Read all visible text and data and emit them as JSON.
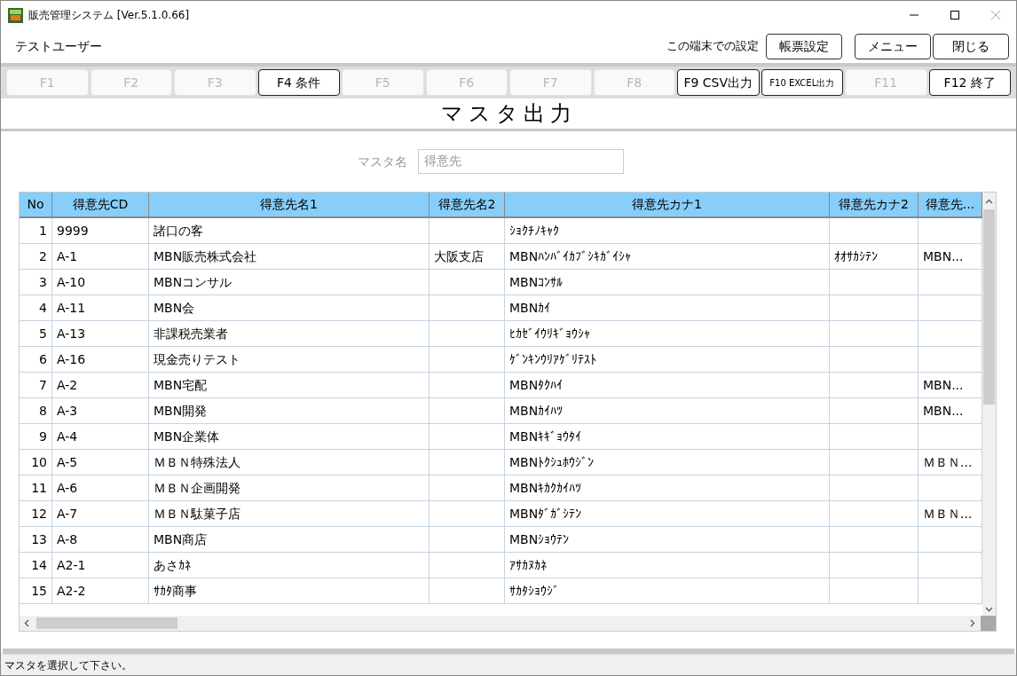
{
  "window": {
    "title": "販売管理システム [Ver.5.1.0.66]"
  },
  "header": {
    "user": "テストユーザー",
    "settings_label": "この端末での設定",
    "buttons": [
      "帳票設定",
      "メニュー",
      "閉じる"
    ]
  },
  "function_keys": [
    {
      "label": "F1",
      "disabled": true
    },
    {
      "label": "F2",
      "disabled": true
    },
    {
      "label": "F3",
      "disabled": true
    },
    {
      "label": "F4 条件",
      "disabled": false
    },
    {
      "label": "F5",
      "disabled": true
    },
    {
      "label": "F6",
      "disabled": true
    },
    {
      "label": "F7",
      "disabled": true
    },
    {
      "label": "F8",
      "disabled": true
    },
    {
      "label": "F9 CSV出力",
      "disabled": false
    },
    {
      "label": "F10 EXCEL出力",
      "disabled": false,
      "kind": "small"
    },
    {
      "label": "F11",
      "disabled": true
    },
    {
      "label": "F12 終了",
      "disabled": false
    }
  ],
  "page_title": "マスタ出力",
  "master_field": {
    "label": "マスタ名",
    "value": "得意先"
  },
  "table": {
    "columns": [
      "No",
      "得意先CD",
      "得意先名1",
      "得意先名2",
      "得意先カナ1",
      "得意先カナ2",
      "得意先..."
    ],
    "rows": [
      {
        "no": "1",
        "code": "9999",
        "name_1": "諸口の客",
        "kana_1": "ｼｮｸﾁﾉｷｬｸ"
      },
      {
        "no": "2",
        "code": "A-1",
        "name_1": "MBN販売株式会社",
        "name_2": "大阪支店",
        "kana_1": "MBNﾊﾝﾊﾞｲｶﾌﾞｼｷｶﾞｲｼｬ",
        "kana_2": "ｵｵｻｶｼﾃﾝ",
        "column_7": "MBN..."
      },
      {
        "no": "3",
        "code": "A-10",
        "name_1": "MBNコンサル",
        "kana_1": "MBNｺﾝｻﾙ"
      },
      {
        "no": "4",
        "code": "A-11",
        "name_1": "MBN会",
        "kana_1": "MBNｶｲ"
      },
      {
        "no": "5",
        "code": "A-13",
        "name_1": "非課税売業者",
        "kana_1": "ﾋｶｾﾞｲｳﾘｷﾞｮｳｼｬ"
      },
      {
        "no": "6",
        "code": "A-16",
        "name_1": "現金売りテスト",
        "kana_1": "ｹﾞﾝｷﾝｳﾘｱｹﾞﾘﾃｽﾄ"
      },
      {
        "no": "7",
        "code": "A-2",
        "name_1": "MBN宅配",
        "kana_1": "MBNﾀｸﾊｲ",
        "column_7": "MBN..."
      },
      {
        "no": "8",
        "code": "A-3",
        "name_1": "MBN開発",
        "kana_1": "MBNｶｲﾊﾂ",
        "column_7": "MBN..."
      },
      {
        "no": "9",
        "code": "A-4",
        "name_1": "MBN企業体",
        "kana_1": "MBNｷｷﾞｮｳﾀｲ"
      },
      {
        "no": "10",
        "code": "A-5",
        "name_1": "ＭＢＮ特殊法人",
        "kana_1": "MBNﾄｸｼｭﾎｳｼﾞﾝ",
        "column_7": "ＭＢＮ..."
      },
      {
        "no": "11",
        "code": "A-6",
        "name_1": "ＭＢＮ企画開発",
        "kana_1": "MBNｷｶｸｶｲﾊﾂ"
      },
      {
        "no": "12",
        "code": "A-7",
        "name_1": "ＭＢＮ駄菓子店",
        "kana_1": "MBNﾀﾞｶﾞｼﾃﾝ",
        "column_7": "ＭＢＮ..."
      },
      {
        "no": "13",
        "code": "A-8",
        "name_1": "MBN商店",
        "kana_1": "MBNｼｮｳﾃﾝ"
      },
      {
        "no": "14",
        "code": "A2-1",
        "name_1": "あさｶﾈ",
        "kana_1": "ｱｻｶﾇｶﾈ"
      },
      {
        "no": "15",
        "code": "A2-2",
        "name_1": "ｻｶﾀ商事",
        "kana_1": "ｻｶﾀｼｮｳｼﾞ"
      }
    ]
  },
  "status_bar": {
    "message": "マスタを選択して下さい。"
  }
}
